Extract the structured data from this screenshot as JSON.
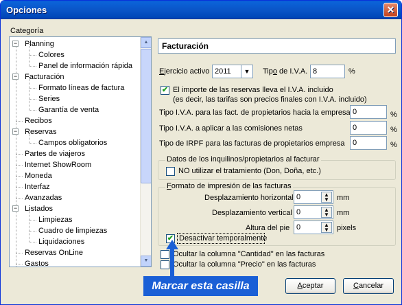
{
  "window": {
    "title": "Opciones",
    "close_glyph": "✕"
  },
  "category": {
    "label": "Categoría",
    "items": [
      {
        "label": "Planning",
        "level": 0,
        "expander": "⊟"
      },
      {
        "label": "Colores",
        "level": 1
      },
      {
        "label": "Panel de información rápida",
        "level": 1
      },
      {
        "label": "Facturación",
        "level": 0,
        "expander": "⊟"
      },
      {
        "label": "Formato líneas de factura",
        "level": 1
      },
      {
        "label": "Series",
        "level": 1
      },
      {
        "label": "Garantía de venta",
        "level": 1
      },
      {
        "label": "Recibos",
        "level": 0
      },
      {
        "label": "Reservas",
        "level": 0,
        "expander": "⊟"
      },
      {
        "label": "Campos obligatorios",
        "level": 1
      },
      {
        "label": "Partes de viajeros",
        "level": 0
      },
      {
        "label": "Internet ShowRoom",
        "level": 0
      },
      {
        "label": "Moneda",
        "level": 0
      },
      {
        "label": "Interfaz",
        "level": 0
      },
      {
        "label": "Avanzadas",
        "level": 0
      },
      {
        "label": "Listados",
        "level": 0,
        "expander": "⊟"
      },
      {
        "label": "Limpiezas",
        "level": 1
      },
      {
        "label": "Cuadro de limpiezas",
        "level": 1
      },
      {
        "label": "Liquidaciones",
        "level": 1
      },
      {
        "label": "Reservas OnLine",
        "level": 0
      },
      {
        "label": "Gastos",
        "level": 0
      }
    ]
  },
  "panel": {
    "heading": "Facturación",
    "ejercicio": {
      "label_u": "E",
      "label_rest": "jercicio activo",
      "value": "2011"
    },
    "iva": {
      "label_pre": "Tip",
      "label_u": "o",
      "label_rest": " de I.V.A.",
      "value": "8",
      "unit": "%"
    },
    "reservas_iva": {
      "checked": true,
      "line1": "El importe de las reservas lleva el I.V.A. incluido",
      "line2": "(es decir, las tarifas son precios finales con I.V.A. incluido)"
    },
    "tipo_iva_propietarios": {
      "label": "Tipo I.V.A. para las fact. de propietarios hacia la empresa",
      "value": "0",
      "unit": "%"
    },
    "tipo_iva_comisiones": {
      "label": "Tipo I.V.A. a aplicar a las comisiones netas",
      "value": "0",
      "unit": "%"
    },
    "tipo_irpf": {
      "label": "Tipo de IRPF para las facturas de propietarios empresa",
      "value": "0",
      "unit": "%"
    },
    "inquilinos_group": {
      "title": "Datos de los inquilinos/propietarios al facturar",
      "no_tratamiento": {
        "checked": false,
        "label": "NO utilizar el tratamiento (Don, Doña, etc.)"
      }
    },
    "formato_group": {
      "title_u": "F",
      "title_rest": "ormato de impresión de las facturas",
      "desp_h": {
        "label": "Desplazamiento horizontal",
        "value": "0",
        "unit": "mm"
      },
      "desp_v": {
        "label": "Desplazamiento vertical",
        "value": "0",
        "unit": "mm"
      },
      "altura_pie": {
        "label": "Altura del pie",
        "value": "0",
        "unit": "pixels"
      },
      "desactivar": {
        "checked": true,
        "label": "Desactivar temporalmente"
      }
    },
    "ocultar_cantidad": {
      "checked": false,
      "label": "Ocultar la columna \"Cantidad\" en las facturas"
    },
    "ocultar_precio": {
      "checked": false,
      "label": "Ocultar la columna \"Precio\" en las facturas"
    }
  },
  "callout": {
    "text": "Marcar esta casilla",
    "color": "#1a5fd6"
  },
  "buttons": {
    "accept": {
      "label_u": "A",
      "label_rest": "ceptar"
    },
    "cancel": {
      "label_u": "C",
      "label_rest": "ancelar"
    }
  }
}
